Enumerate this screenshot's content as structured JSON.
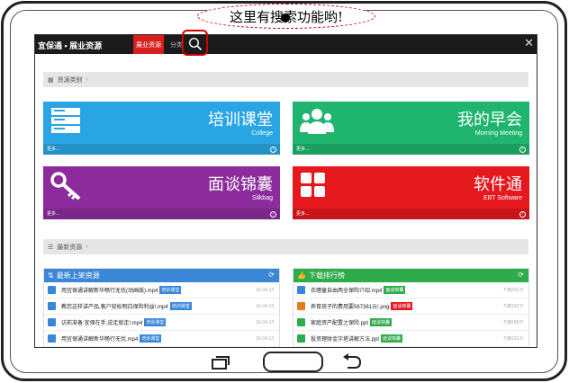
{
  "callout": {
    "text": "这里有搜索功能哟!"
  },
  "header": {
    "brand": "宜保通 • 展业资源",
    "active_tab": "展业资源",
    "category_tab": "分类"
  },
  "sections": {
    "resource_category": "资源类别",
    "latest_resources": "最新资源"
  },
  "tiles": [
    {
      "title": "培训课堂",
      "subtitle": "College",
      "footer": "更多...",
      "color": "#29a5e3",
      "icon": "server-icon"
    },
    {
      "title": "我的早会",
      "subtitle": "Morning Meeting",
      "footer": "更多...",
      "color": "#1fb56e",
      "icon": "people-icon"
    },
    {
      "title": "面谈锦囊",
      "subtitle": "Silkbag",
      "footer": "更多...",
      "color": "#8c2c9c",
      "icon": "key-icon"
    },
    {
      "title": "软件通",
      "subtitle": "EBT Software",
      "footer": "更多...",
      "color": "#e5181e",
      "icon": "grid-icon"
    }
  ],
  "panels": {
    "latest": {
      "title": "最新上架资源",
      "color": "#3a87d8",
      "rows": [
        {
          "name": "用宜保通讲解新华畅行无忧(动画版).mp4",
          "tag": "培训课堂",
          "meta": "16-04-13"
        },
        {
          "name": "教您这样讲产品,客户轻松明白保险利益!.mp4",
          "tag": "培训课堂",
          "meta": "16-04-13"
        },
        {
          "name": "访前准备:宜保在手,说走就走!.mp4",
          "tag": "培训课堂",
          "meta": "16-04-13"
        },
        {
          "name": "用宜保通讲解新华畅行无忧.mp4",
          "tag": "培训课堂",
          "meta": "16-04-13"
        }
      ]
    },
    "ranking": {
      "title": "下载排行榜",
      "color": "#2eab4b",
      "rows": [
        {
          "name": "衣缠童自由两全保险介绍.mp4",
          "tag": "面谈锦囊",
          "meta": "下载226次",
          "tagcolor": "#2eab4b",
          "iconcolor": "#3a87d8"
        },
        {
          "name": "养育孩子的费用要567361元!.png",
          "tag": "面谈锦囊",
          "meta": "下载162次",
          "tagcolor": "#e5181e",
          "iconcolor": "#e57a1e"
        },
        {
          "name": "家庭资产配置之保险.ppt",
          "tag": "面谈锦囊",
          "meta": "下载158次",
          "tagcolor": "#2eab4b",
          "iconcolor": "#2eab4b"
        },
        {
          "name": "投资理财金字塔讲解方法.ppt",
          "tag": "面谈锦囊",
          "meta": "下载122次",
          "tagcolor": "#2eab4b",
          "iconcolor": "#2eab4b"
        }
      ]
    }
  }
}
